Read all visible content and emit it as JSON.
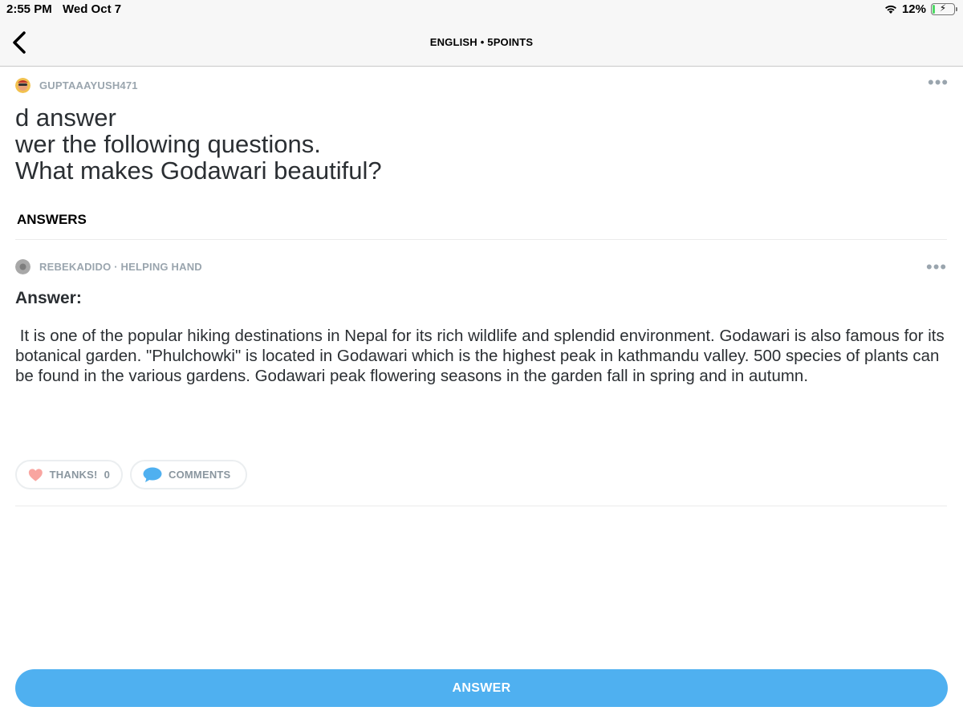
{
  "status_bar": {
    "time": "2:55 PM",
    "date": "Wed Oct 7",
    "battery_percent": "12%",
    "battery_level": 0.12,
    "icons": [
      "wifi-icon",
      "battery-icon",
      "charging-bolt-icon"
    ]
  },
  "nav": {
    "title": "ENGLISH • 5POINTS",
    "back_icon": "chevron-left-icon"
  },
  "question": {
    "author": "GUPTAAAYUSH471",
    "lines": [
      "d answer",
      "wer the following questions.",
      "What makes Godawari beautiful?"
    ],
    "more_icon": "more-dots-icon"
  },
  "answers_heading": "ANSWERS",
  "answer": {
    "author": "REBEKADIDO · HELPING HAND",
    "label": "Answer:",
    "body": " It is one of the popular hiking destinations in Nepal for its rich wildlife and splendid environment. Godawari is also famous for its botanical garden. \"Phulchowki\" is located in Godawari which is the highest peak in kathmandu valley. 500 species of plants can be found in the various gardens. Godawari peak flowering seasons in the garden fall in spring and in autumn.",
    "thanks_label": "THANKS!",
    "thanks_count": "0",
    "comments_label": "COMMENTS"
  },
  "answer_button": "ANSWER",
  "colors": {
    "accent": "#4fb0f0",
    "heart": "#f9a5a0",
    "comment_bubble": "#4fb0f0",
    "muted_text": "#9aa5ae"
  }
}
